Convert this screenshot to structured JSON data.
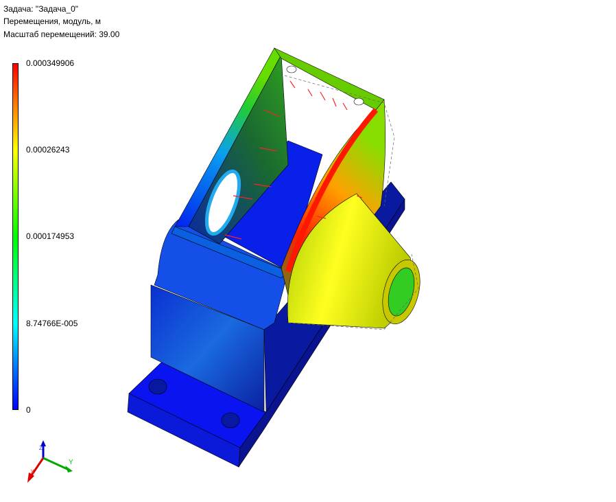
{
  "header": {
    "task": "Задача: \"Задача_0\"",
    "result": "Перемещения, модуль, м",
    "scale": "Масштаб перемещений: 39.00"
  },
  "legend": {
    "ticks": [
      "0.000349906",
      "0.00026243",
      "0.000174953",
      "8.74766E-005",
      "0"
    ],
    "colors": [
      "#ff0000",
      "#ffff00",
      "#00ff00",
      "#00ffff",
      "#0000ff"
    ]
  },
  "triad": {
    "x": "X",
    "y": "Y",
    "z": "Z"
  }
}
